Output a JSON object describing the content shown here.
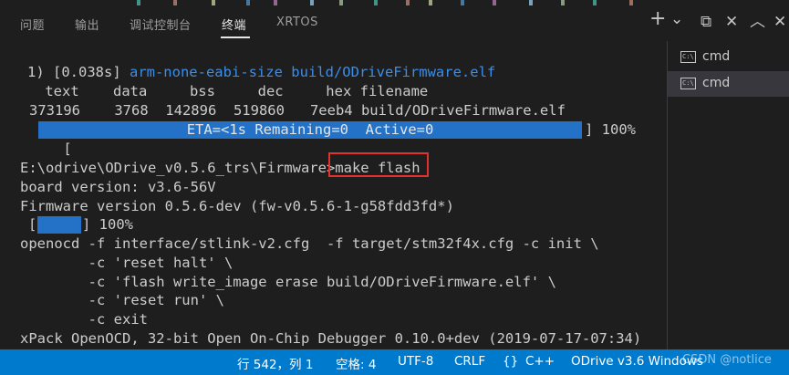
{
  "panel": {
    "tabs": [
      "问题",
      "输出",
      "调试控制台",
      "终端",
      "XRTOS"
    ],
    "active_tab": "终端",
    "actions": {
      "add": "+",
      "add_dropdown": "⌄",
      "split": "⧉",
      "close": "✕",
      "maximize": "︿",
      "close_panel": "✕"
    }
  },
  "terminal": {
    "lines": {
      "l1_prefix": "1) [0.038s] ",
      "l1_cmd": "arm-none-eabi-size build/ODriveFirmware.elf",
      "l2": " text    data     bss     dec     hex filename",
      "l3": "373196    3768  142896  519860   7eeb4 build/ODriveFirmware.elf",
      "l4_open": "[",
      "l4_bar": "ETA=<1s Remaining=0  Active=0",
      "l4_close": "] 100%",
      "l5": "",
      "l6_prompt": "E:\\odrive\\ODrive_v0.5.6_trs\\Firmware>",
      "l6_cmd": "make flash",
      "l7": "board version: v3.6-56V",
      "l8": "Firmware version 0.5.6-dev (fw-v0.5.6-1-g58fdd3fd*)",
      "l9_open": "[",
      "l9_close": "] 100%",
      "l10": "openocd -f interface/stlink-v2.cfg  -f target/stm32f4x.cfg -c init \\",
      "l11": "        -c 'reset halt' \\",
      "l12": "        -c 'flash write_image erase build/ODriveFirmware.elf' \\",
      "l13": "        -c 'reset run' \\",
      "l14": "        -c exit",
      "l15": "xPack OpenOCD, 32-bit Open On-Chip Debugger 0.10.0+dev (2019-07-17-07:34)"
    }
  },
  "terminal_list": {
    "icon_text": "C:\\",
    "items": [
      {
        "label": "cmd"
      },
      {
        "label": "cmd"
      }
    ]
  },
  "statusbar": {
    "position": "行 542，列 1",
    "indent": "空格: 4",
    "encoding": "UTF-8",
    "eol": "CRLF",
    "language_icon": "{}",
    "language": "C++",
    "config": "ODrive v3.6 Windows",
    "watermark": "CSDN @notlice"
  },
  "colors": {
    "background": "#1e1e1e",
    "statusbar": "#007acc",
    "progress": "#2472c8",
    "highlight_text": "#3b8eea",
    "annotation_box": "#e3312d"
  }
}
